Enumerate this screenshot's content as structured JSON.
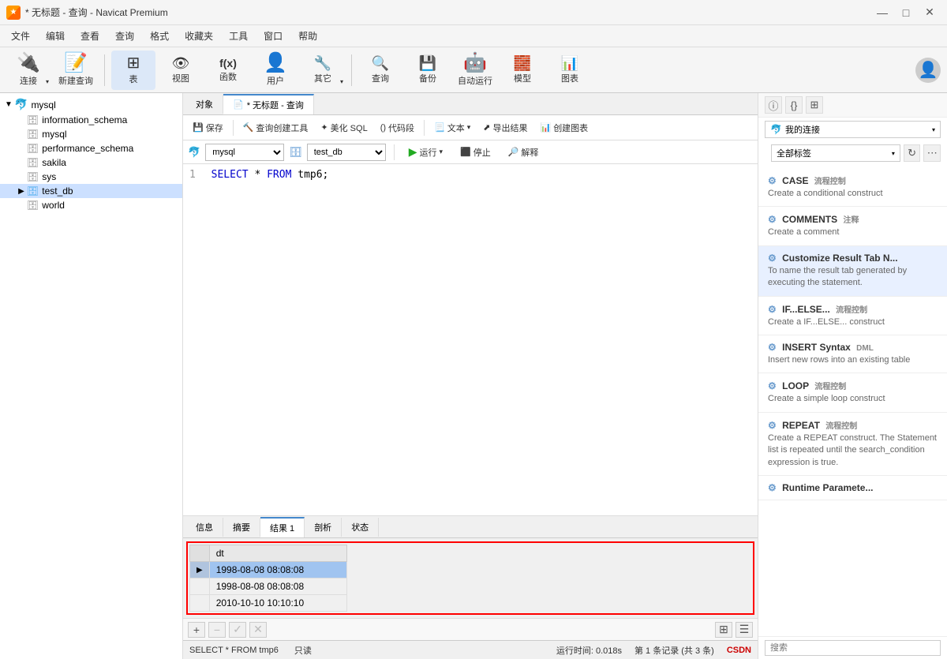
{
  "titleBar": {
    "icon": "★",
    "title": "* 无标题 - 查询 - Navicat Premium",
    "minimizeBtn": "—",
    "maximizeBtn": "□",
    "closeBtn": "✕"
  },
  "menuBar": {
    "items": [
      "文件",
      "编辑",
      "查看",
      "查询",
      "格式",
      "收藏夹",
      "工具",
      "窗口",
      "帮助"
    ]
  },
  "toolbar": {
    "buttons": [
      {
        "id": "connect",
        "icon": "🔌",
        "label": "连接",
        "hasArrow": true
      },
      {
        "id": "new-query",
        "icon": "📄",
        "label": "新建查询"
      },
      {
        "id": "table",
        "icon": "⊞",
        "label": "表",
        "active": true
      },
      {
        "id": "view",
        "icon": "👁",
        "label": "视图"
      },
      {
        "id": "function",
        "icon": "f(x)",
        "label": "函数"
      },
      {
        "id": "user",
        "icon": "👤",
        "label": "用户"
      },
      {
        "id": "other",
        "icon": "🔧",
        "label": "其它",
        "hasArrow": true
      },
      {
        "id": "query2",
        "icon": "📋",
        "label": "查询"
      },
      {
        "id": "backup",
        "icon": "↩",
        "label": "备份"
      },
      {
        "id": "autorun",
        "icon": "🤖",
        "label": "自动运行"
      },
      {
        "id": "model",
        "icon": "🧱",
        "label": "模型"
      },
      {
        "id": "chart",
        "icon": "📊",
        "label": "图表"
      }
    ]
  },
  "sidebar": {
    "items": [
      {
        "id": "mysql-root",
        "label": "mysql",
        "type": "root",
        "expanded": true,
        "icon": "🐬"
      },
      {
        "id": "information_schema",
        "label": "information_schema",
        "type": "db",
        "indent": 1
      },
      {
        "id": "mysql",
        "label": "mysql",
        "type": "db",
        "indent": 1
      },
      {
        "id": "performance_schema",
        "label": "performance_schema",
        "type": "db",
        "indent": 1
      },
      {
        "id": "sakila",
        "label": "sakila",
        "type": "db",
        "indent": 1
      },
      {
        "id": "sys",
        "label": "sys",
        "type": "db",
        "indent": 1
      },
      {
        "id": "test_db",
        "label": "test_db",
        "type": "db",
        "indent": 1,
        "selected": true,
        "expanded": true
      },
      {
        "id": "world",
        "label": "world",
        "type": "db",
        "indent": 1
      }
    ]
  },
  "objectTab": {
    "label": "对象"
  },
  "queryTab": {
    "icon": "📄",
    "label": "* 无标题 - 查询"
  },
  "queryToolbar": {
    "save": "保存",
    "queryBuilder": "查询创建工具",
    "beautifySQL": "美化 SQL",
    "codeSnippet": "代码段",
    "text": "文本",
    "exportResult": "导出结果",
    "createChart": "创建图表"
  },
  "dbSelector": {
    "db1": "mysql",
    "db2": "test_db",
    "runBtn": "运行",
    "stopBtn": "停止",
    "explainBtn": "解释"
  },
  "codeEditor": {
    "line1": "SELECT * FROM tmp6;"
  },
  "resultTabs": {
    "tabs": [
      "信息",
      "摘要",
      "结果 1",
      "剖析",
      "状态"
    ],
    "activeTab": "结果 1"
  },
  "resultTable": {
    "headers": [
      "dt"
    ],
    "rows": [
      {
        "values": [
          "1998-08-08 08:08:08"
        ],
        "selected": true,
        "hasArrow": true
      },
      {
        "values": [
          "1998-08-08 08:08:08"
        ],
        "selected": false
      },
      {
        "values": [
          "2010-10-10 10:10:10"
        ],
        "selected": false
      }
    ]
  },
  "resultToolbar": {
    "addBtn": "+",
    "deleteBtn": "−",
    "checkBtn": "✓",
    "cancelBtn": "✕"
  },
  "statusBar": {
    "sql": "SELECT * FROM tmp6",
    "readOnly": "只读",
    "runTime": "运行时间: 0.018s",
    "recordInfo": "第 1 条记录 (共 3 条)"
  },
  "snippetPanel": {
    "infoBtn": "ℹ",
    "codeBtn": "{}",
    "gridBtn": "⊞",
    "connectionLabel": "我的连接",
    "tagLabel": "全部标签",
    "refreshBtn": "↻",
    "snippets": [
      {
        "id": "case",
        "title": "CASE",
        "tag": "流程控制",
        "desc": "Create a conditional construct"
      },
      {
        "id": "comments",
        "title": "COMMENTS",
        "tag": "注释",
        "desc": "Create a comment"
      },
      {
        "id": "customize",
        "title": "Customize Result Tab N...",
        "tag": "",
        "desc": "To name the result tab generated by executing the statement.",
        "active": true
      },
      {
        "id": "ifelse",
        "title": "IF...ELSE...",
        "tag": "流程控制",
        "desc": "Create a IF...ELSE... construct"
      },
      {
        "id": "insert-syntax",
        "title": "INSERT Syntax",
        "tag": "DML",
        "desc": "Insert new rows into an existing table"
      },
      {
        "id": "loop",
        "title": "LOOP",
        "tag": "流程控制",
        "desc": "Create a simple loop construct"
      },
      {
        "id": "repeat",
        "title": "REPEAT",
        "tag": "流程控制",
        "desc": "Create a REPEAT construct. The Statement list is repeated until the search_condition expression is true."
      },
      {
        "id": "runtime-params",
        "title": "Runtime Paramete...",
        "tag": "",
        "desc": ""
      }
    ],
    "searchPlaceholder": "搜索"
  }
}
